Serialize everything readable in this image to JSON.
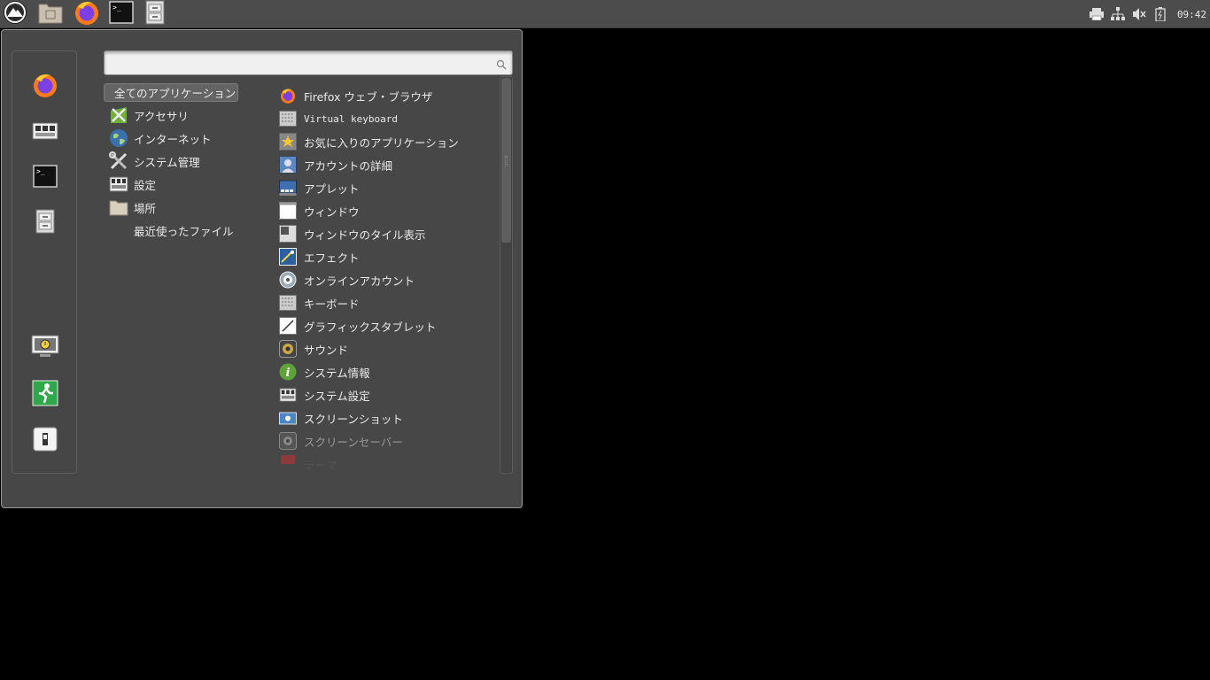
{
  "panel": {
    "launchers": [
      {
        "name": "menu-button",
        "icon": "distro-logo-icon"
      },
      {
        "name": "home-folder-launcher",
        "icon": "home-folder-icon"
      },
      {
        "name": "firefox-launcher",
        "icon": "firefox-icon"
      },
      {
        "name": "terminal-launcher",
        "icon": "terminal-icon"
      },
      {
        "name": "file-manager-launcher",
        "icon": "filing-cabinet-icon"
      }
    ],
    "tray": {
      "icons": [
        "printer-icon",
        "network-icon",
        "volume-muted-icon",
        "battery-charging-icon"
      ],
      "clock": "09:42"
    }
  },
  "menu": {
    "search": {
      "value": "",
      "placeholder": ""
    },
    "favorites": [
      "firefox-icon",
      "settings-manager-icon",
      "terminal-icon",
      "file-manager-icon",
      "lock-screen-icon",
      "logout-icon",
      "switch-user-icon"
    ],
    "categories": [
      {
        "label": "全てのアプリケーション",
        "icon": "",
        "selected": true
      },
      {
        "label": "アクセサリ",
        "icon": "accessories-icon"
      },
      {
        "label": "インターネット",
        "icon": "globe-icon"
      },
      {
        "label": "システム管理",
        "icon": "tools-icon"
      },
      {
        "label": "設定",
        "icon": "settings-icon"
      },
      {
        "label": "場所",
        "icon": "folder-icon"
      },
      {
        "label": "最近使ったファイル",
        "icon": ""
      }
    ],
    "apps": [
      {
        "label": "Firefox ウェブ・ブラウザ",
        "icon": "firefox-icon"
      },
      {
        "label": "Virtual keyboard",
        "icon": "keyboard-icon",
        "mono": true
      },
      {
        "label": "お気に入りのアプリケーション",
        "icon": "star-icon"
      },
      {
        "label": "アカウントの詳細",
        "icon": "user-account-icon"
      },
      {
        "label": "アプレット",
        "icon": "applet-icon"
      },
      {
        "label": "ウィンドウ",
        "icon": "window-icon"
      },
      {
        "label": "ウィンドウのタイル表示",
        "icon": "window-tile-icon"
      },
      {
        "label": "エフェクト",
        "icon": "effects-icon"
      },
      {
        "label": "オンラインアカウント",
        "icon": "online-accounts-icon"
      },
      {
        "label": "キーボード",
        "icon": "keyboard-icon"
      },
      {
        "label": "グラフィックスタブレット",
        "icon": "tablet-icon"
      },
      {
        "label": "サウンド",
        "icon": "sound-icon"
      },
      {
        "label": "システム情報",
        "icon": "info-icon"
      },
      {
        "label": "システム設定",
        "icon": "settings-icon"
      },
      {
        "label": "スクリーンショット",
        "icon": "screenshot-icon"
      },
      {
        "label": "スクリーンセーバー",
        "icon": "screensaver-icon",
        "dim": true
      },
      {
        "label": "テーマ",
        "icon": "theme-icon",
        "fade": true
      }
    ]
  },
  "colors": {
    "panel": "#4c4c4c",
    "menu_bg": "#474747",
    "desktop": "#000000",
    "text": "#eaeaea"
  }
}
